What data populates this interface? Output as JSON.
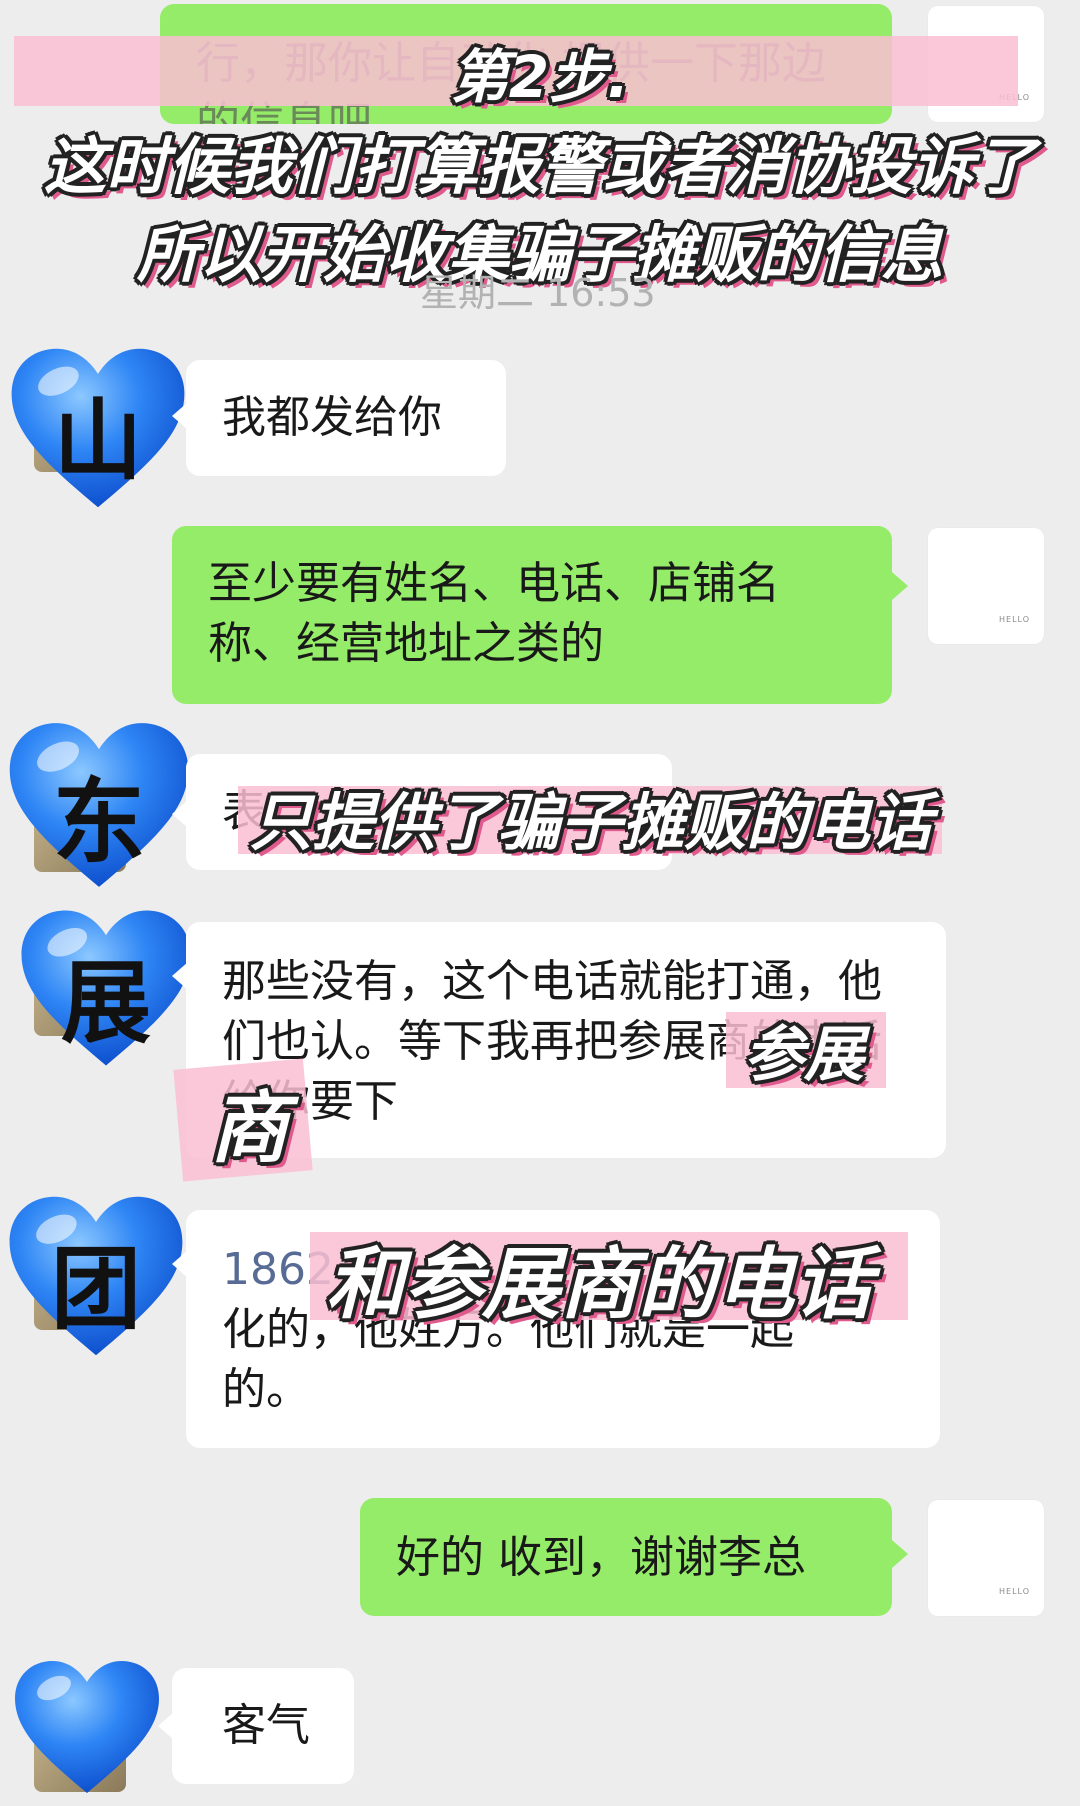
{
  "messages": {
    "m0": "行，那你让自动化 提供一下那边的信息吧",
    "m1": "我都发给你",
    "m2": "至少要有姓名、电话、店铺名称、经营地址之类的",
    "m3": "表",
    "m4": "那些没有，这个电话就能打通，他们也认。等下我再把参展商的电话给你要下",
    "m5_number": "1862",
    "m5": "化的，他姓万。他们就是一起的。",
    "m6": "好的 收到，谢谢李总",
    "m7": "客气"
  },
  "timestamp": "星期二 16:53",
  "self_avatar_text": "HELLO",
  "hearts": [
    "山",
    "东",
    "展",
    "团",
    ""
  ],
  "overlays": {
    "step_title": "第2步.",
    "step_line1": "这时候我们打算报警或者消协投诉了",
    "step_line2": "所以开始收集骗子摊贩的信息",
    "only_phone": "只提供了骗子摊贩的电话",
    "exhibitor_a": "参展",
    "exhibitor_b": "商",
    "and_exhibitor_phone": "和参展商的电话"
  },
  "colors": {
    "outgoing_bubble": "#95ec69",
    "incoming_bubble": "#ffffff",
    "background": "#ededed",
    "heart": "#2a7df0",
    "highlight": "#fabed2"
  }
}
